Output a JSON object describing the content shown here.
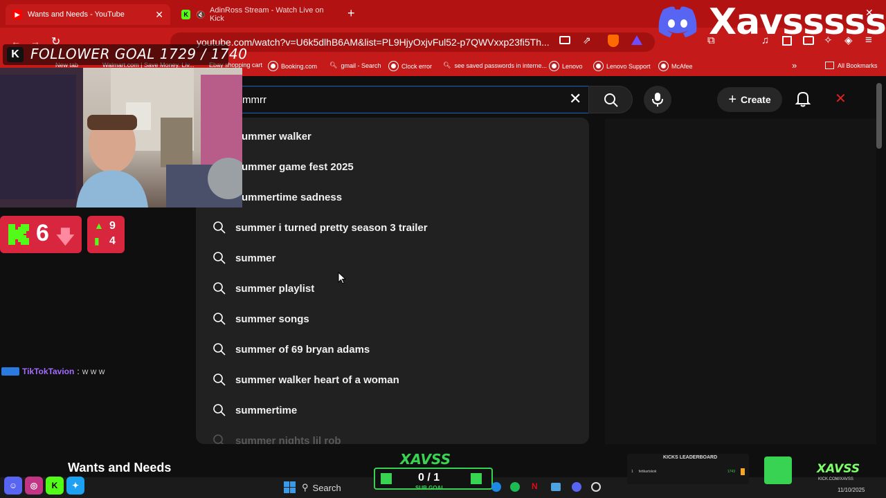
{
  "browser": {
    "tabs": [
      {
        "label": "Wants and Needs - YouTube",
        "active": true
      },
      {
        "label": "AdinRoss Stream - Watch Live on Kick",
        "active": false
      }
    ],
    "url": "youtube.com/watch?v=U6k5dlhB6AM&list=PL9HjyOxjvFul52-p7QWVxxp23fi5Th...",
    "bookmarks": [
      "New tab",
      "Walmart.com | Save Money. Liv...",
      "Ebay shopping cart",
      "Booking.com",
      "gmail - Search",
      "Clock error",
      "see saved passwords in interne...",
      "Lenovo",
      "Lenovo Support",
      "McAfee"
    ],
    "all_bookmarks": "All Bookmarks"
  },
  "youtube": {
    "search_value": "mmrr",
    "create_label": "Create",
    "suggestions": [
      "ummer walker",
      "ummer game fest 2025",
      "ummertime sadness",
      "summer i turned pretty season 3 trailer",
      "summer",
      "summer playlist",
      "summer songs",
      "summer of 69 bryan adams",
      "summer walker heart of a woman",
      "summertime",
      "summer nights lil rob"
    ],
    "now_playing": "Wants and Needs"
  },
  "overlay": {
    "follower_goal": "FOLLOWER GOAL 1729 / 1740",
    "streamer_name": "Xavsssss",
    "viewers": "6",
    "stat_up": "9",
    "stat_bar": "4",
    "chat": {
      "user": "TikTokTavion",
      "message": "w w w"
    },
    "sub_goal_title": "XAVSS",
    "sub_goal_count": "0 / 1",
    "sub_goal_label": "SUB GOAL",
    "leaderboard_title": "KICKS LEADERBOARD",
    "leaderboard_rank": "1",
    "leaderboard_user": "fettkartskok",
    "leaderboard_value": "1743",
    "brand_small": "XAVSS",
    "brand_url": "KICK.COM/XAVSS"
  },
  "taskbar": {
    "search_label": "Search",
    "date": "11/10/2025"
  },
  "colors": {
    "browser_red": "#c41a1a",
    "youtube_bg": "#0f0f0f",
    "kick_green": "#39d353",
    "accent_blue": "#1c62b9"
  }
}
